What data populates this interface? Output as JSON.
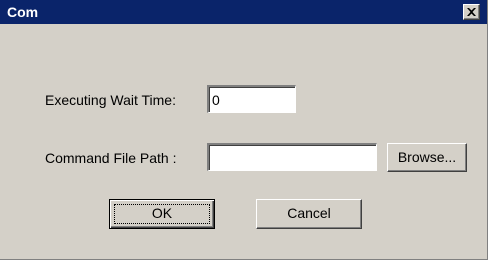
{
  "window": {
    "title": "Com",
    "close_icon": "close-icon"
  },
  "form": {
    "wait_time_label": "Executing Wait Time:",
    "wait_time_value": "0",
    "command_path_label": "Command File Path  :",
    "command_path_value": "",
    "browse_label": "Browse..."
  },
  "buttons": {
    "ok_label": "OK",
    "cancel_label": "Cancel"
  },
  "colors": {
    "titlebar": "#0a246a",
    "dialog_face": "#d4d0c8"
  }
}
